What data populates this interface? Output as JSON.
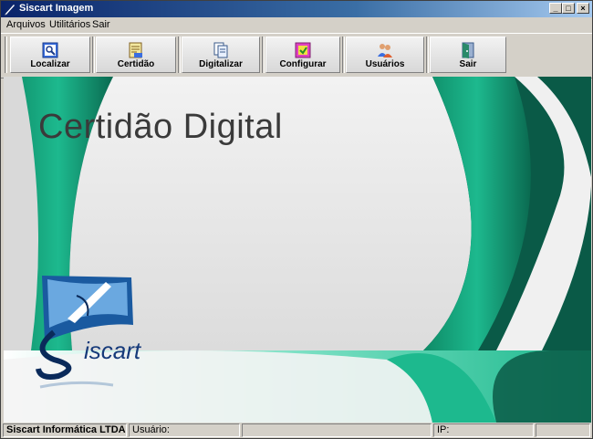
{
  "window": {
    "title": "Siscart Imagem"
  },
  "menu": {
    "items": [
      "Arquivos",
      "Utilitários",
      "Sair"
    ]
  },
  "toolbar": {
    "buttons": [
      "Localizar",
      "Certidão",
      "Digitalizar",
      "Configurar",
      "Usuários",
      "Sair"
    ]
  },
  "main": {
    "heading": "Certidão Digital",
    "logo_text": "iscart"
  },
  "status": {
    "company": "Siscart Informática LTDA.",
    "user_label": "Usuário:",
    "ip_label": "IP:"
  },
  "colors": {
    "title_blue": "#0a246a",
    "teal": "#1db98e",
    "dark_green": "#0a5a47"
  }
}
